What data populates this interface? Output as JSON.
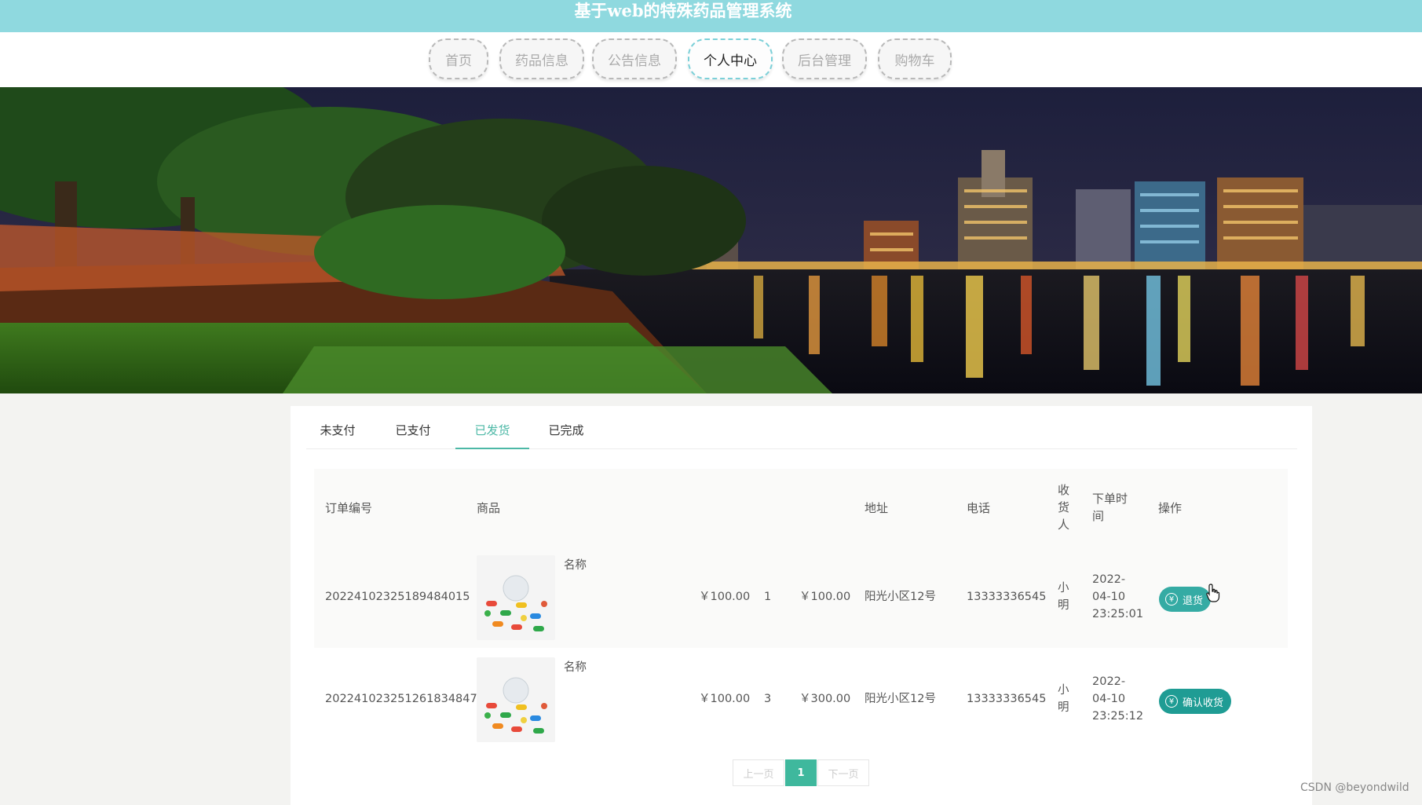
{
  "header": {
    "title": "基于web的特殊药品管理系统",
    "bar_color": "#8fd9df"
  },
  "nav": {
    "items": [
      {
        "label": "首页"
      },
      {
        "label": "药品信息"
      },
      {
        "label": "公告信息"
      },
      {
        "label": "个人中心",
        "active": true
      },
      {
        "label": "后台管理"
      },
      {
        "label": "购物车"
      }
    ]
  },
  "banner": {
    "subject": "night city skyline across a lake with park trees"
  },
  "orders": {
    "tabs": [
      {
        "label": "未支付"
      },
      {
        "label": "已支付"
      },
      {
        "label": "已发货",
        "active": true
      },
      {
        "label": "已完成"
      }
    ],
    "columns": {
      "order_no": "订单编号",
      "product": "商品",
      "address": "地址",
      "phone": "电话",
      "receiver": "收货人",
      "order_time": "下单时间",
      "action": "操作"
    },
    "rows": [
      {
        "order_no": "20224102325189484015",
        "name": "名称",
        "price": "￥100.00",
        "qty": "1",
        "total": "￥100.00",
        "address": "阳光小区12号",
        "phone": "13333336545",
        "receiver": "小明",
        "time_date": "2022-04-10",
        "time_clock": "23:25:01",
        "action": "退货"
      },
      {
        "order_no": "20224102325126183484 7",
        "name": "名称",
        "price": "￥100.00",
        "qty": "3",
        "total": "￥300.00",
        "address": "阳光小区12号",
        "phone": "13333336545",
        "receiver": "小明",
        "time_date": "2022-04-10",
        "time_clock": "23:25:12",
        "action": "确认收货"
      }
    ],
    "pager": {
      "prev": "上一页",
      "current": "1",
      "next": "下一页"
    }
  },
  "watermark": "CSDN @beyondwild",
  "accent_color": "#1f9c94"
}
